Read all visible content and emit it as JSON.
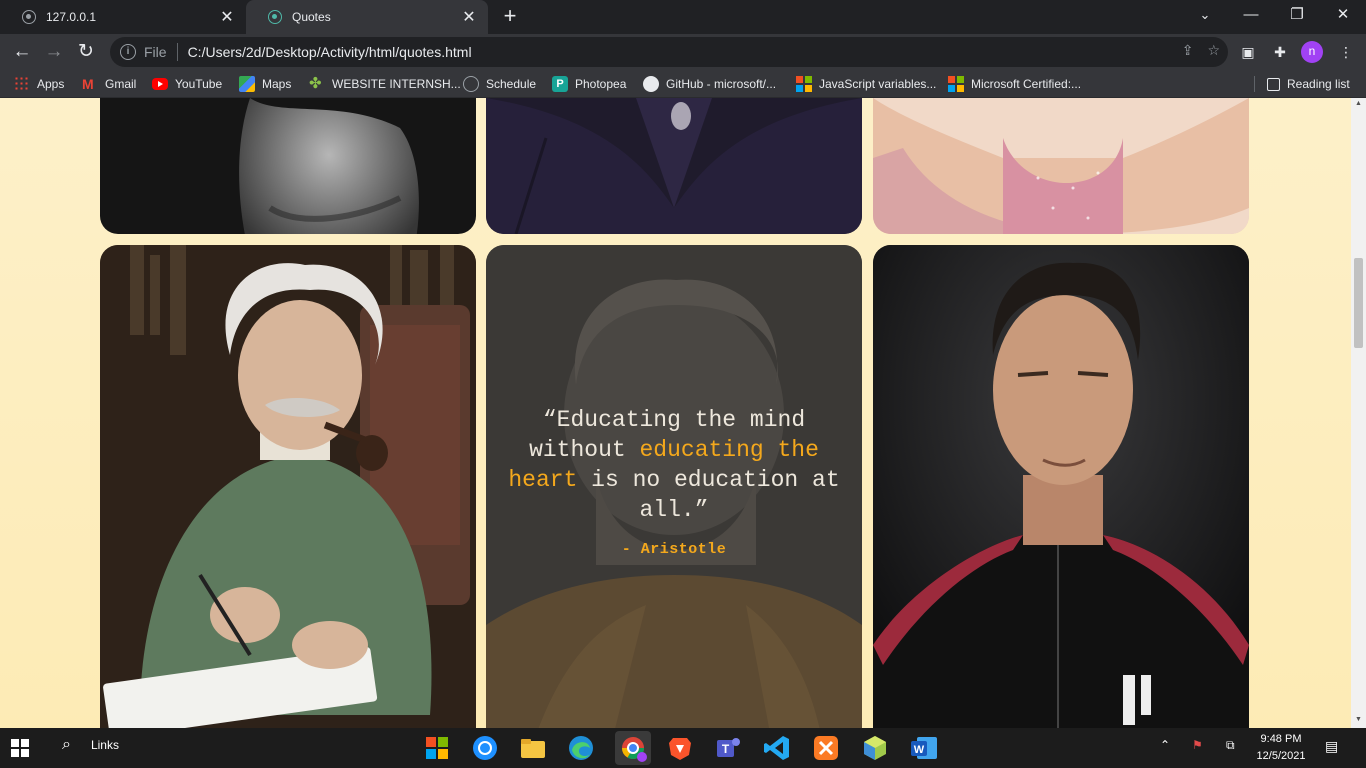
{
  "browser": {
    "tabs": [
      {
        "title": "127.0.0.1",
        "active": false
      },
      {
        "title": "Quotes",
        "active": true
      }
    ],
    "omnibox": {
      "scheme": "File",
      "url": "C:/Users/2d/Desktop/Activity/html/quotes.html"
    },
    "profile_initial": "n",
    "reading_list_label": "Reading list"
  },
  "bookmarks": [
    {
      "label": "Apps",
      "icon": "apps-grid-icon"
    },
    {
      "label": "Gmail",
      "icon": "gmail-icon"
    },
    {
      "label": "YouTube",
      "icon": "youtube-icon"
    },
    {
      "label": "Maps",
      "icon": "maps-icon"
    },
    {
      "label": "WEBSITE INTERNSH...",
      "icon": "website-icon"
    },
    {
      "label": "Schedule",
      "icon": "globe-icon"
    },
    {
      "label": "Photopea",
      "icon": "photopea-icon"
    },
    {
      "label": "GitHub - microsoft/...",
      "icon": "github-icon"
    },
    {
      "label": "JavaScript variables...",
      "icon": "microsoft-icon"
    },
    {
      "label": "Microsoft Certified:...",
      "icon": "microsoft-icon"
    }
  ],
  "quote_card": {
    "quote_part1": "“Educating the mind without ",
    "quote_highlight": "educating the heart",
    "quote_part2": " is no education at all.”",
    "author": "- Aristotle"
  },
  "taskbar": {
    "search_label": "Links",
    "time": "9:48 PM",
    "date": "12/5/2021"
  },
  "colors": {
    "page_bg": "#fdebb5",
    "highlight": "#f4a81c",
    "quote_text": "#ede7dc"
  }
}
